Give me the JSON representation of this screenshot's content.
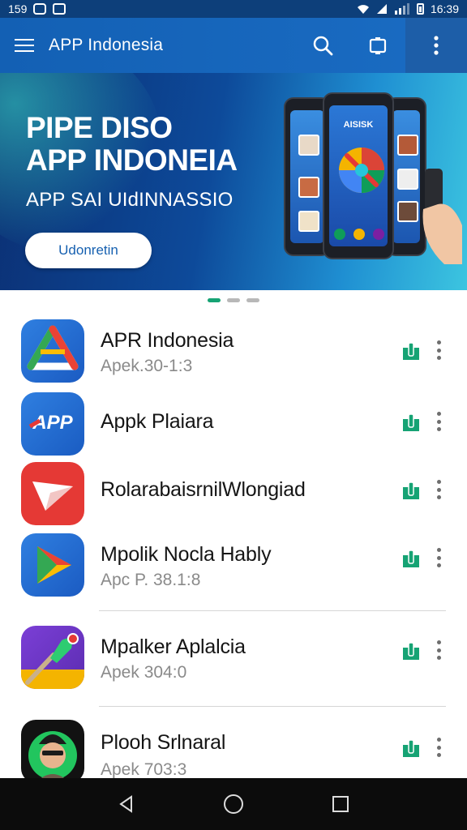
{
  "status_bar": {
    "left_text": "159",
    "time": "16:39"
  },
  "app_bar": {
    "title": "APP Indonesia"
  },
  "banner": {
    "title_line1": "PIPE DISO",
    "title_line2": "APP INDONEIA",
    "subtitle": "APP SAI UIdINNASSIO",
    "cta_label": "Udonretin",
    "phone_screen_text": "AISISK"
  },
  "pager": {
    "count": 3,
    "active_index": 0
  },
  "apps": [
    {
      "name": "APR Indonesia",
      "subtitle": "Apek.30-1:3",
      "icon": "drive-triangle-icon"
    },
    {
      "name": "Appk Plaiara",
      "subtitle": "",
      "icon": "app-logo-icon",
      "icon_text": "APP"
    },
    {
      "name": "RolarabaisrnilWlongiad",
      "subtitle": "",
      "icon": "paper-plane-icon"
    },
    {
      "name": "Mpolik Nocla Hably",
      "subtitle": "Apc P. 38.1:8",
      "icon": "play-triangle-icon"
    },
    {
      "name": "Mpalker Aplalcia",
      "subtitle": "Apek 304:0",
      "icon": "brush-icon"
    },
    {
      "name": "Plooh Srlnaral",
      "subtitle": "Apek 703:3",
      "icon": "avatar-icon"
    }
  ],
  "colors": {
    "accent": "#16a374",
    "app_bar": "#1360b4",
    "nav_bar": "#0c0c0c"
  }
}
